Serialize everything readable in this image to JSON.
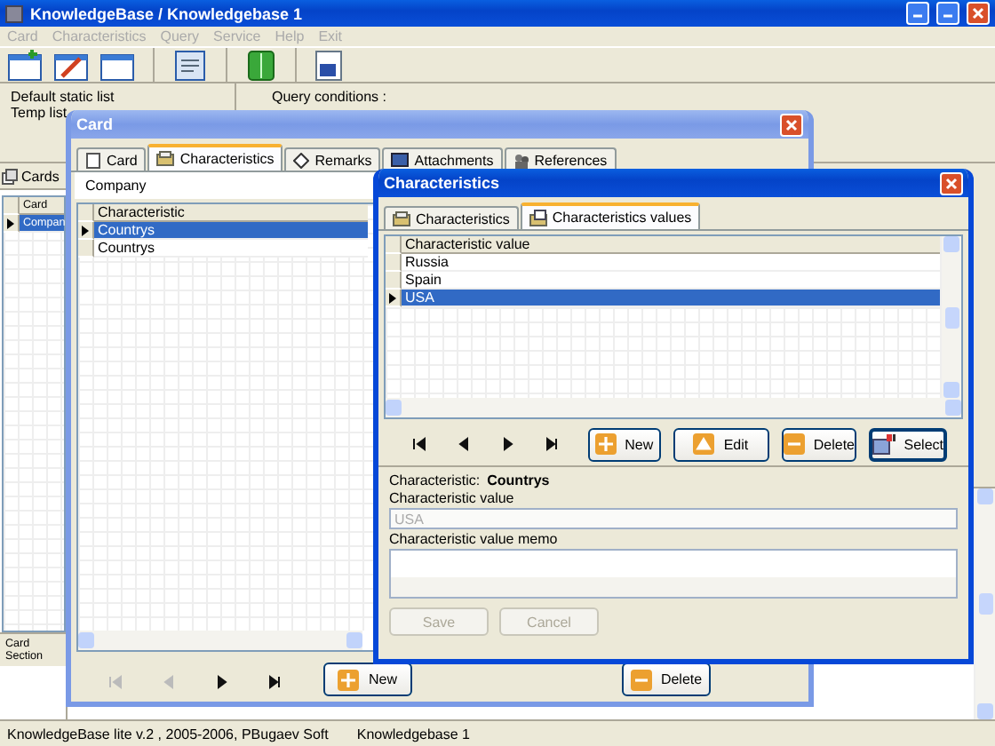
{
  "main_window": {
    "title": "KnowledgeBase / Knowledgebase 1",
    "menu": [
      "Card",
      "Characteristics",
      "Query",
      "Service",
      "Help",
      "Exit"
    ],
    "lists": [
      "Default static list",
      "Temp list"
    ],
    "query_label": "Query conditions :",
    "cards_tab": "Cards",
    "cards_grid": {
      "columns": [
        "Card"
      ],
      "rows": [
        {
          "cells": [
            "Compan"
          ],
          "selected": true
        }
      ]
    },
    "detail_labels": [
      "Card",
      "Section"
    ],
    "status_bar": [
      "KnowledgeBase lite v.2 , 2005-2006, PBugaev Soft",
      "Knowledgebase 1"
    ]
  },
  "card_window": {
    "title": "Card",
    "tabs": [
      {
        "label": "Card",
        "kind": "card",
        "selected": false
      },
      {
        "label": "Characteristics",
        "kind": "characteristics",
        "selected": true
      },
      {
        "label": "Remarks",
        "kind": "remarks",
        "selected": false
      },
      {
        "label": "Attachments",
        "kind": "attachments",
        "selected": false
      },
      {
        "label": "References",
        "kind": "references",
        "selected": false
      }
    ],
    "company": "Company",
    "grid": {
      "columns": [
        "Characteristic"
      ],
      "rows": [
        {
          "cells": [
            "Countrys"
          ],
          "selected": true
        },
        {
          "cells": [
            "Countrys"
          ],
          "selected": false
        }
      ]
    },
    "nav": [
      {
        "kind": "first",
        "disabled": true
      },
      {
        "kind": "prev",
        "disabled": true
      },
      {
        "kind": "next",
        "disabled": false
      },
      {
        "kind": "last",
        "disabled": false
      }
    ],
    "buttons": [
      {
        "kind": "new",
        "label": "New"
      },
      {
        "kind": "delete",
        "label": "Delete"
      }
    ]
  },
  "characteristics_window": {
    "title": "Characteristics",
    "tabs": [
      {
        "label": "Characteristics",
        "kind": "characteristics",
        "selected": false
      },
      {
        "label": "Characteristics values",
        "kind": "values",
        "selected": true
      }
    ],
    "grid": {
      "columns": [
        "Characteristic value"
      ],
      "rows": [
        {
          "cells": [
            "Russia"
          ],
          "selected": false
        },
        {
          "cells": [
            "Spain"
          ],
          "selected": false
        },
        {
          "cells": [
            "USA"
          ],
          "selected": true
        }
      ]
    },
    "nav": [
      {
        "kind": "first",
        "disabled": false
      },
      {
        "kind": "prev",
        "disabled": false
      },
      {
        "kind": "next",
        "disabled": false
      },
      {
        "kind": "last",
        "disabled": false
      }
    ],
    "buttons": [
      {
        "kind": "new",
        "label": "New"
      },
      {
        "kind": "edit",
        "label": "Edit"
      },
      {
        "kind": "delete",
        "label": "Delete"
      },
      {
        "kind": "select",
        "label": "Select"
      }
    ],
    "characteristic_label": "Characteristic:",
    "characteristic_name": "Countrys",
    "value_label": "Characteristic value",
    "value": {
      "value": "USA",
      "disabled": true
    },
    "memo_label": "Characteristic value memo",
    "actions": [
      {
        "label": "Save",
        "disabled": true
      },
      {
        "label": "Cancel",
        "disabled": true
      }
    ]
  }
}
